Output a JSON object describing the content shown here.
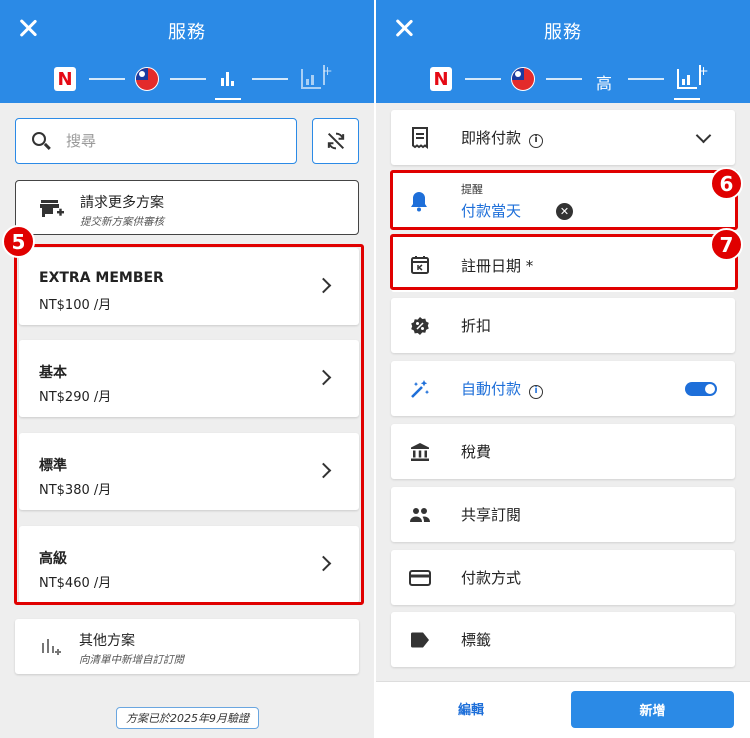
{
  "left": {
    "header": {
      "title": "服務"
    },
    "search": {
      "placeholder": "搜尋"
    },
    "request_card": {
      "title": "請求更多方案",
      "subtitle": "提交新方案供審核"
    },
    "badge": "5",
    "plans": [
      {
        "name": "EXTRA MEMBER",
        "price": "NT$100 /月"
      },
      {
        "name": "基本",
        "price": "NT$290 /月"
      },
      {
        "name": "標準",
        "price": "NT$380 /月"
      },
      {
        "name": "高級",
        "price": "NT$460 /月"
      }
    ],
    "other_card": {
      "title": "其他方案",
      "subtitle": "向清單中新增自訂訂閱"
    },
    "verified_note": "方案已於2025年9月驗證"
  },
  "right": {
    "header": {
      "title": "服務",
      "plan_step": "高"
    },
    "rows": {
      "upcoming": "即將付款",
      "reminder_label": "提醒",
      "reminder_value": "付款當天",
      "register_date": "註冊日期 *",
      "discount": "折扣",
      "autopay": "自動付款",
      "tax": "稅費",
      "shared": "共享訂閱",
      "payment_method": "付款方式",
      "tags": "標籤"
    },
    "badges": {
      "six": "6",
      "seven": "7"
    },
    "footer": {
      "edit": "編輯",
      "add": "新增"
    }
  },
  "colors": {
    "primary": "#2b8ae6",
    "highlight": "#e00000",
    "link": "#1e6fd9",
    "netflix": "#e50914"
  },
  "icons": [
    "close-icon",
    "netflix-logo",
    "taiwan-flag-icon",
    "bar-chart-icon",
    "add-chart-icon",
    "search-icon",
    "sync-off-icon",
    "store-add-icon",
    "chevron-right-icon",
    "receipt-icon",
    "info-icon",
    "chevron-down-icon",
    "bell-icon",
    "calendar-icon",
    "discount-icon",
    "magic-wand-icon",
    "bank-icon",
    "people-icon",
    "credit-card-icon",
    "label-icon"
  ]
}
